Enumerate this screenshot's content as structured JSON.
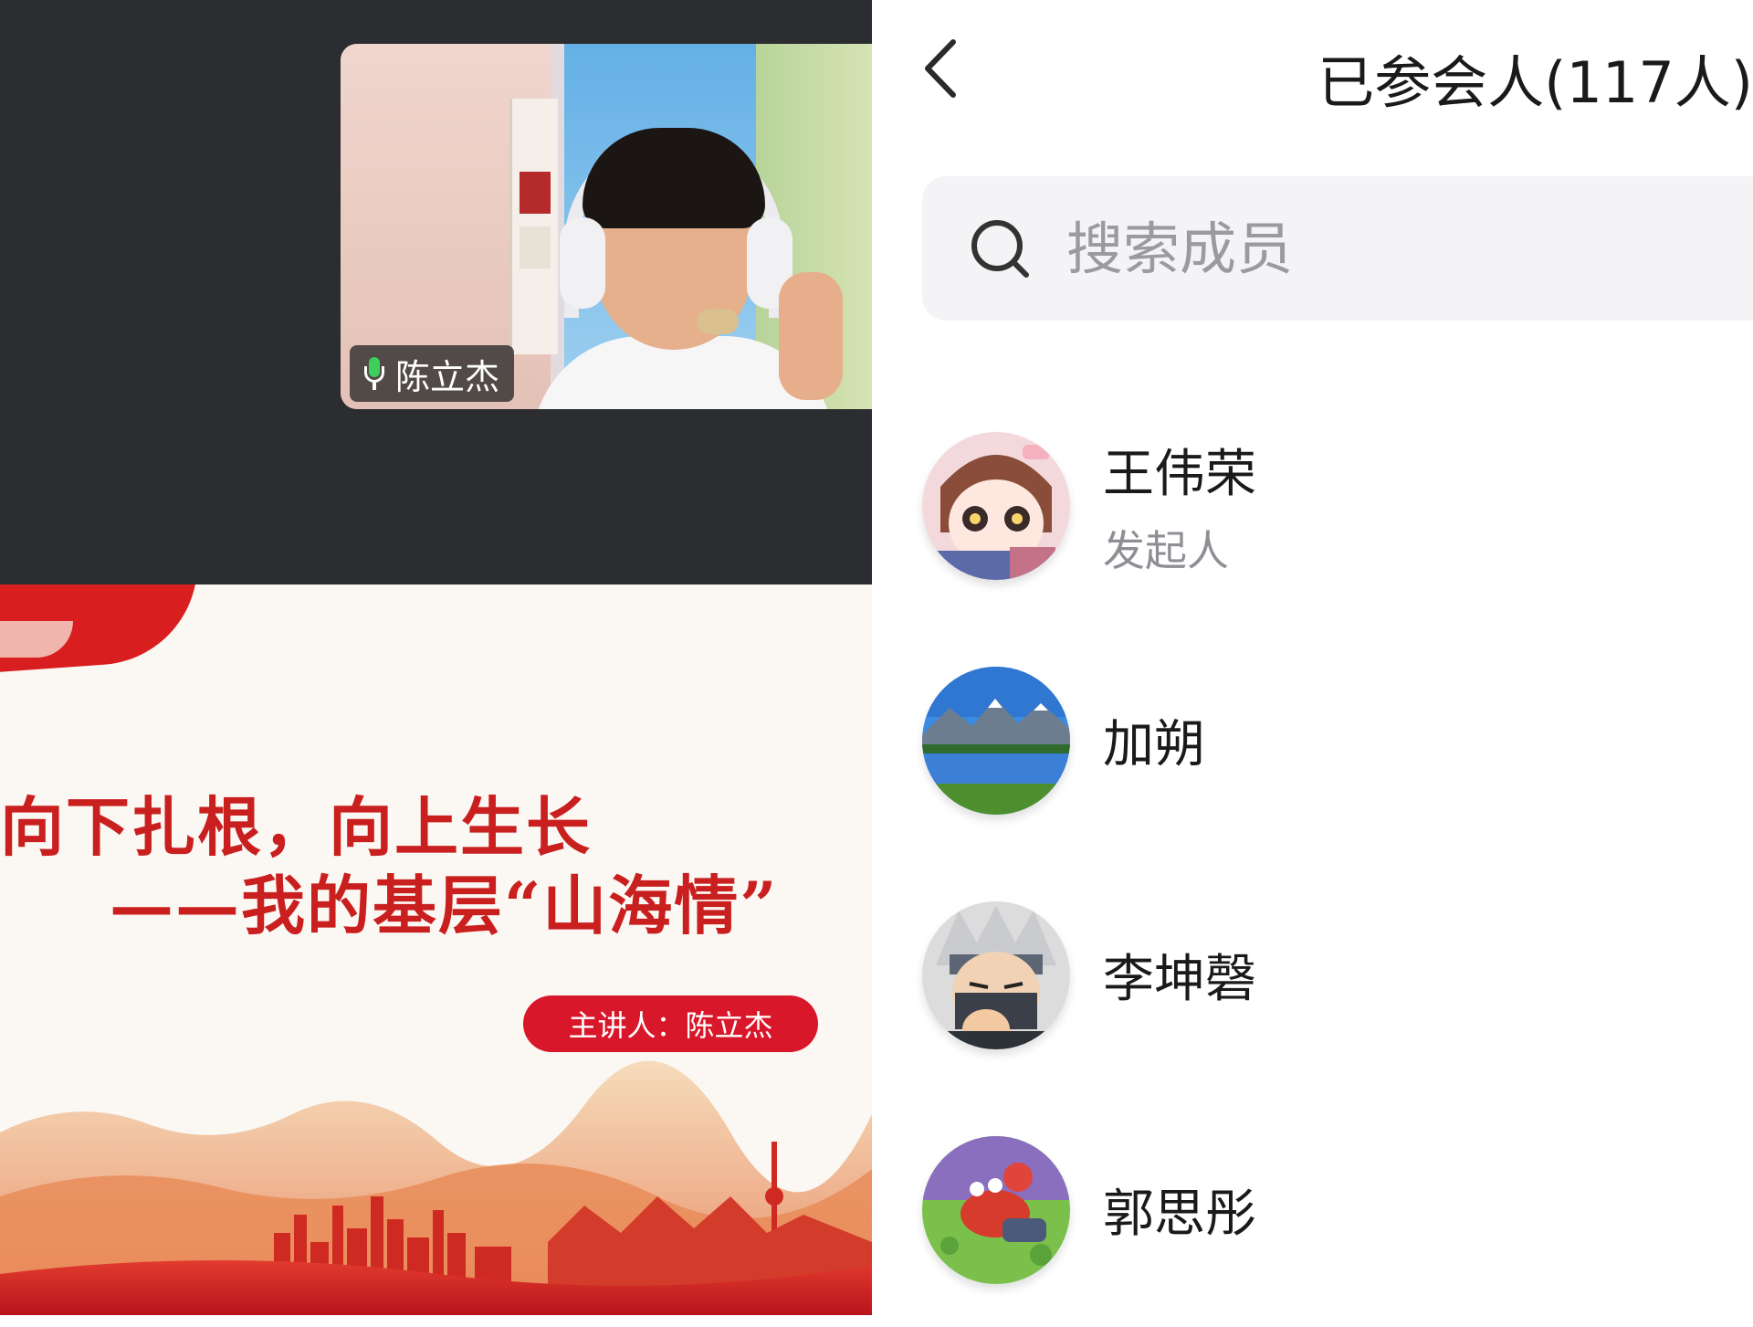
{
  "meeting": {
    "camera": {
      "speaker_name": "陈立杰"
    },
    "slide": {
      "title_line1": "向下扎根，向上生长",
      "title_line2": "——我的基层“山海情”",
      "presenter_label": "主讲人：陈立杰"
    }
  },
  "participants_panel": {
    "title": "已参会人(117人)",
    "search": {
      "placeholder": "搜索成员",
      "value": ""
    },
    "members": [
      {
        "name": "王伟荣",
        "role": "发起人",
        "avatar": "anime-girl-avatar"
      },
      {
        "name": "加朔",
        "role": "",
        "avatar": "mountain-lake-avatar"
      },
      {
        "name": "李坤磬",
        "role": "",
        "avatar": "ninja-avatar"
      },
      {
        "name": "郭思彤",
        "role": "",
        "avatar": "cartoon-crab-avatar"
      }
    ]
  },
  "icons": {
    "back": "chevron-left-icon",
    "search": "search-icon",
    "mic": "microphone-icon"
  },
  "colors": {
    "accent_red": "#d9172a",
    "mic_green": "#3ecf5a",
    "video_bg": "#2b2d30"
  }
}
